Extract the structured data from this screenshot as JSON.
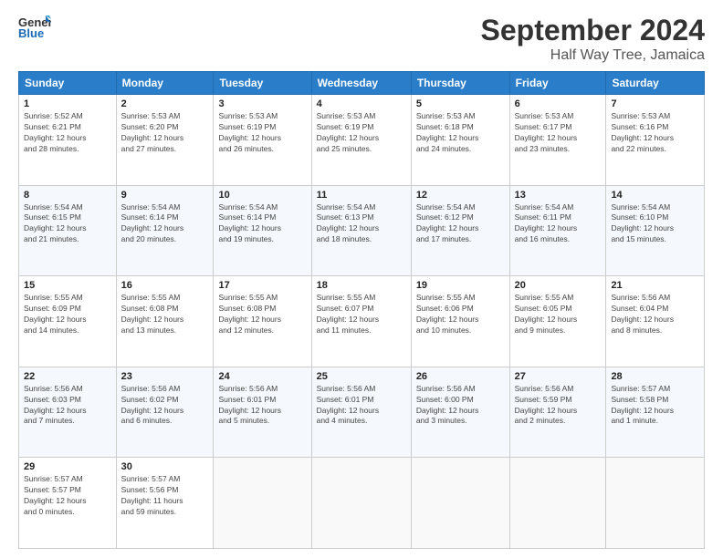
{
  "header": {
    "logo_line1": "General",
    "logo_line2": "Blue",
    "month": "September 2024",
    "location": "Half Way Tree, Jamaica"
  },
  "days_of_week": [
    "Sunday",
    "Monday",
    "Tuesday",
    "Wednesday",
    "Thursday",
    "Friday",
    "Saturday"
  ],
  "weeks": [
    [
      {
        "day": "1",
        "info": "Sunrise: 5:52 AM\nSunset: 6:21 PM\nDaylight: 12 hours\nand 28 minutes."
      },
      {
        "day": "2",
        "info": "Sunrise: 5:53 AM\nSunset: 6:20 PM\nDaylight: 12 hours\nand 27 minutes."
      },
      {
        "day": "3",
        "info": "Sunrise: 5:53 AM\nSunset: 6:19 PM\nDaylight: 12 hours\nand 26 minutes."
      },
      {
        "day": "4",
        "info": "Sunrise: 5:53 AM\nSunset: 6:19 PM\nDaylight: 12 hours\nand 25 minutes."
      },
      {
        "day": "5",
        "info": "Sunrise: 5:53 AM\nSunset: 6:18 PM\nDaylight: 12 hours\nand 24 minutes."
      },
      {
        "day": "6",
        "info": "Sunrise: 5:53 AM\nSunset: 6:17 PM\nDaylight: 12 hours\nand 23 minutes."
      },
      {
        "day": "7",
        "info": "Sunrise: 5:53 AM\nSunset: 6:16 PM\nDaylight: 12 hours\nand 22 minutes."
      }
    ],
    [
      {
        "day": "8",
        "info": "Sunrise: 5:54 AM\nSunset: 6:15 PM\nDaylight: 12 hours\nand 21 minutes."
      },
      {
        "day": "9",
        "info": "Sunrise: 5:54 AM\nSunset: 6:14 PM\nDaylight: 12 hours\nand 20 minutes."
      },
      {
        "day": "10",
        "info": "Sunrise: 5:54 AM\nSunset: 6:14 PM\nDaylight: 12 hours\nand 19 minutes."
      },
      {
        "day": "11",
        "info": "Sunrise: 5:54 AM\nSunset: 6:13 PM\nDaylight: 12 hours\nand 18 minutes."
      },
      {
        "day": "12",
        "info": "Sunrise: 5:54 AM\nSunset: 6:12 PM\nDaylight: 12 hours\nand 17 minutes."
      },
      {
        "day": "13",
        "info": "Sunrise: 5:54 AM\nSunset: 6:11 PM\nDaylight: 12 hours\nand 16 minutes."
      },
      {
        "day": "14",
        "info": "Sunrise: 5:54 AM\nSunset: 6:10 PM\nDaylight: 12 hours\nand 15 minutes."
      }
    ],
    [
      {
        "day": "15",
        "info": "Sunrise: 5:55 AM\nSunset: 6:09 PM\nDaylight: 12 hours\nand 14 minutes."
      },
      {
        "day": "16",
        "info": "Sunrise: 5:55 AM\nSunset: 6:08 PM\nDaylight: 12 hours\nand 13 minutes."
      },
      {
        "day": "17",
        "info": "Sunrise: 5:55 AM\nSunset: 6:08 PM\nDaylight: 12 hours\nand 12 minutes."
      },
      {
        "day": "18",
        "info": "Sunrise: 5:55 AM\nSunset: 6:07 PM\nDaylight: 12 hours\nand 11 minutes."
      },
      {
        "day": "19",
        "info": "Sunrise: 5:55 AM\nSunset: 6:06 PM\nDaylight: 12 hours\nand 10 minutes."
      },
      {
        "day": "20",
        "info": "Sunrise: 5:55 AM\nSunset: 6:05 PM\nDaylight: 12 hours\nand 9 minutes."
      },
      {
        "day": "21",
        "info": "Sunrise: 5:56 AM\nSunset: 6:04 PM\nDaylight: 12 hours\nand 8 minutes."
      }
    ],
    [
      {
        "day": "22",
        "info": "Sunrise: 5:56 AM\nSunset: 6:03 PM\nDaylight: 12 hours\nand 7 minutes."
      },
      {
        "day": "23",
        "info": "Sunrise: 5:56 AM\nSunset: 6:02 PM\nDaylight: 12 hours\nand 6 minutes."
      },
      {
        "day": "24",
        "info": "Sunrise: 5:56 AM\nSunset: 6:01 PM\nDaylight: 12 hours\nand 5 minutes."
      },
      {
        "day": "25",
        "info": "Sunrise: 5:56 AM\nSunset: 6:01 PM\nDaylight: 12 hours\nand 4 minutes."
      },
      {
        "day": "26",
        "info": "Sunrise: 5:56 AM\nSunset: 6:00 PM\nDaylight: 12 hours\nand 3 minutes."
      },
      {
        "day": "27",
        "info": "Sunrise: 5:56 AM\nSunset: 5:59 PM\nDaylight: 12 hours\nand 2 minutes."
      },
      {
        "day": "28",
        "info": "Sunrise: 5:57 AM\nSunset: 5:58 PM\nDaylight: 12 hours\nand 1 minute."
      }
    ],
    [
      {
        "day": "29",
        "info": "Sunrise: 5:57 AM\nSunset: 5:57 PM\nDaylight: 12 hours\nand 0 minutes."
      },
      {
        "day": "30",
        "info": "Sunrise: 5:57 AM\nSunset: 5:56 PM\nDaylight: 11 hours\nand 59 minutes."
      },
      {
        "day": "",
        "info": ""
      },
      {
        "day": "",
        "info": ""
      },
      {
        "day": "",
        "info": ""
      },
      {
        "day": "",
        "info": ""
      },
      {
        "day": "",
        "info": ""
      }
    ]
  ]
}
